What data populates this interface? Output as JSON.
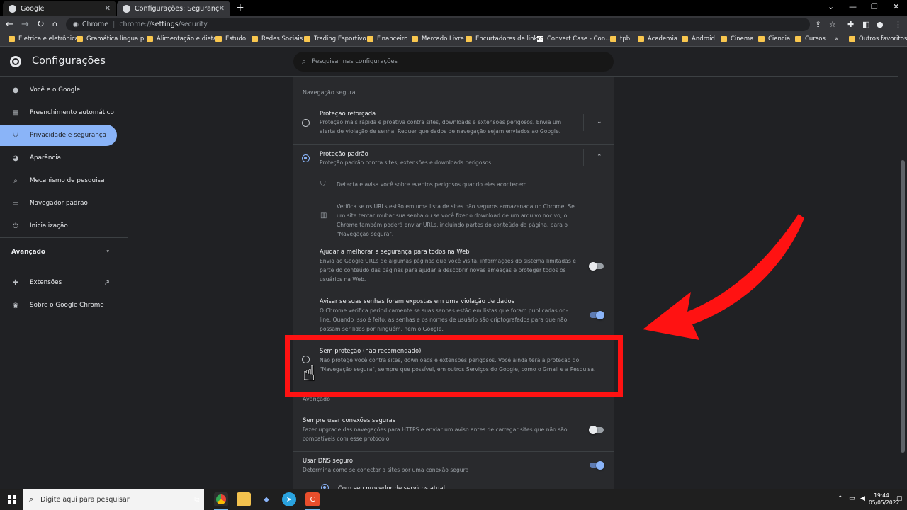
{
  "browser": {
    "tabs": [
      {
        "label": "Google",
        "close": "✕"
      },
      {
        "label": "Configurações: Segurança",
        "close": "✕"
      }
    ],
    "new_tab": "+",
    "site_label": "Chrome",
    "url_prefix": "chrome://",
    "url_bold": "settings",
    "url_suffix": "/security",
    "bookmarks": [
      "Eletrica e eletrônica",
      "Gramática língua p...",
      "Alimentação e dieta",
      "Estudo",
      "Redes Sociais",
      "Trading Esportivo",
      "Financeiro",
      "Mercado Livre",
      "Encurtadores de links",
      "Convert Case - Con...",
      "tpb",
      "Academia",
      "Android",
      "Cinema",
      "Ciencia",
      "Cursos"
    ],
    "bookmarks_more": "»",
    "other_bookmarks": "Outros favoritos",
    "convert_case_icon_text": "CC"
  },
  "settings": {
    "title": "Configurações",
    "search_placeholder": "Pesquisar nas configurações",
    "sidebar": [
      {
        "label": "Você e o Google",
        "icon": "person-icon"
      },
      {
        "label": "Preenchimento automático",
        "icon": "clipboard-icon"
      },
      {
        "label": "Privacidade e segurança",
        "icon": "shield-icon"
      },
      {
        "label": "Aparência",
        "icon": "palette-icon"
      },
      {
        "label": "Mecanismo de pesquisa",
        "icon": "search-icon"
      },
      {
        "label": "Navegador padrão",
        "icon": "browser-icon"
      },
      {
        "label": "Inicialização",
        "icon": "power-icon"
      }
    ],
    "advanced": "Avançado",
    "extensions": "Extensões",
    "about": "Sobre o Google Chrome",
    "section_title": "Navegação segura",
    "options": {
      "enhanced": {
        "title": "Proteção reforçada",
        "desc": "Proteção mais rápida e proativa contra sites, downloads e extensões perigosos. Envia um alerta de violação de senha. Requer que dados de navegação sejam enviados ao Google."
      },
      "standard": {
        "title": "Proteção padrão",
        "desc": "Proteção padrão contra sites, extensões e downloads perigosos.",
        "detail1": "Detecta e avisa você sobre eventos perigosos quando eles acontecem",
        "detail2": "Verifica se os URLs estão em uma lista de sites não seguros armazenada no Chrome. Se um site tentar roubar sua senha ou se você fizer o download de um arquivo nocivo, o Chrome também poderá enviar URLs, incluindo partes do conteúdo da página, para o \"Navegação segura\"."
      },
      "help_improve": {
        "title": "Ajudar a melhorar a segurança para todos na Web",
        "desc": "Envia ao Google URLs de algumas páginas que você visita, informações do sistema limitadas e parte do conteúdo das páginas para ajudar a descobrir novas ameaças e proteger todos os usuários na Web."
      },
      "password_alert": {
        "title": "Avisar se suas senhas forem expostas em uma violação de dados",
        "desc": "O Chrome verifica periodicamente se suas senhas estão em listas que foram publicadas on-line. Quando isso é feito, as senhas e os nomes de usuário são criptografados para que não possam ser lidos por ninguém, nem o Google."
      },
      "no_protection": {
        "title": "Sem proteção (não recomendado)",
        "desc": "Não protege você contra sites, downloads e extensões perigosos. Você ainda terá a proteção do \"Navegação segura\", sempre que possível, em outros Serviços do Google, como o Gmail e a Pesquisa."
      }
    },
    "advanced_section": "Avançado",
    "https": {
      "title": "Sempre usar conexões seguras",
      "desc": "Fazer upgrade das navegações para HTTPS e enviar um aviso antes de carregar sites que não são compatíveis com esse protocolo"
    },
    "dns": {
      "title": "Usar DNS seguro",
      "desc": "Determina como se conectar a sites por uma conexão segura",
      "option1": "Com seu provedor de serviços atual"
    },
    "selected_option": "standard",
    "toggles": {
      "help_improve": false,
      "password_alert": true,
      "https": false,
      "dns": true
    }
  },
  "taskbar": {
    "search_placeholder": "Digite aqui para pesquisar",
    "time": "19:44",
    "date": "05/05/2022"
  },
  "colors": {
    "accent": "#8ab4f8",
    "highlight": "#ff1212"
  }
}
